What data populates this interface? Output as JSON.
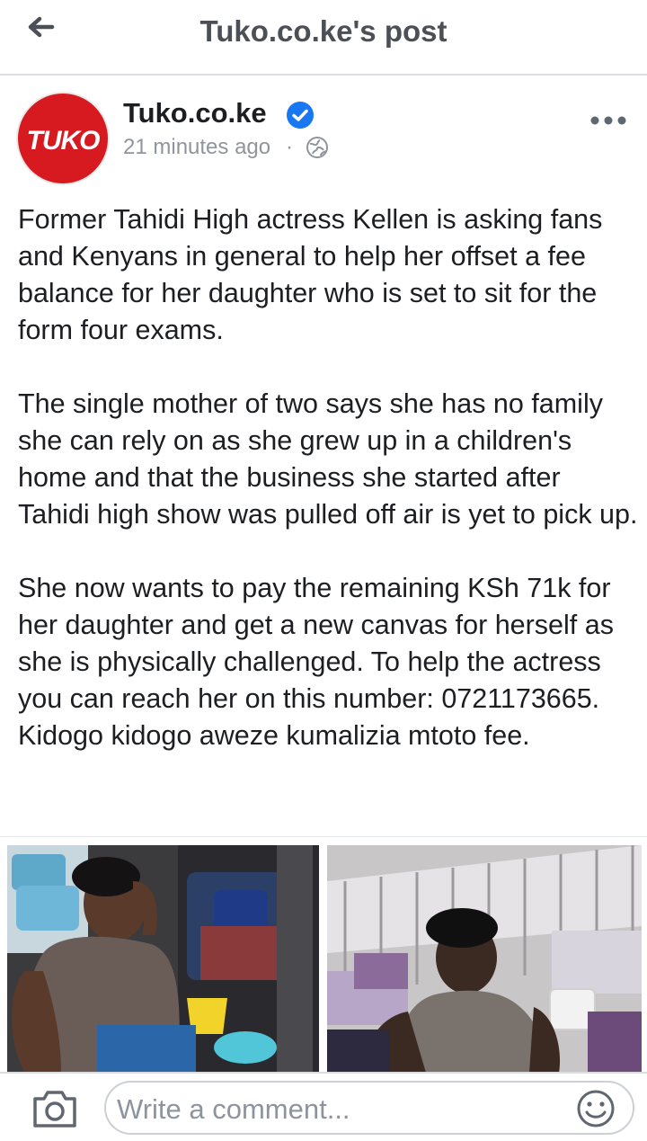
{
  "header": {
    "title": "Tuko.co.ke's post",
    "back_icon": "back-arrow-icon"
  },
  "post": {
    "page_name": "Tuko.co.ke",
    "avatar_text": "TUKO",
    "verified_icon": "verified-badge-icon",
    "timestamp": "21 minutes ago",
    "separator": "·",
    "privacy_icon": "globe-icon",
    "more_icon": "more-options-icon",
    "paragraphs": [
      "Former Tahidi High actress Kellen is asking fans and Kenyans in general to help her offset a fee balance for her daughter who is set to sit for the form four exams.",
      "The single mother of two says she has no family she can rely on as she grew up in a children's home and that the business she started after Tahidi high show was pulled off air is yet to pick up.",
      "She now wants to pay the remaining KSh 71k for her daughter and get a new canvas for herself as she is physically challenged. To help the actress you can reach her on this number: 0721173665. Kidogo kidogo aweze kumalizia mtoto fee."
    ],
    "photo_count": 2
  },
  "comment_bar": {
    "placeholder": "Write a comment...",
    "camera_icon": "camera-icon",
    "emoji_icon": "emoji-icon"
  },
  "colors": {
    "brand_red": "#d71920",
    "verified_blue": "#1877f2",
    "muted_text": "#90949c",
    "title_text": "#4b4f56"
  }
}
